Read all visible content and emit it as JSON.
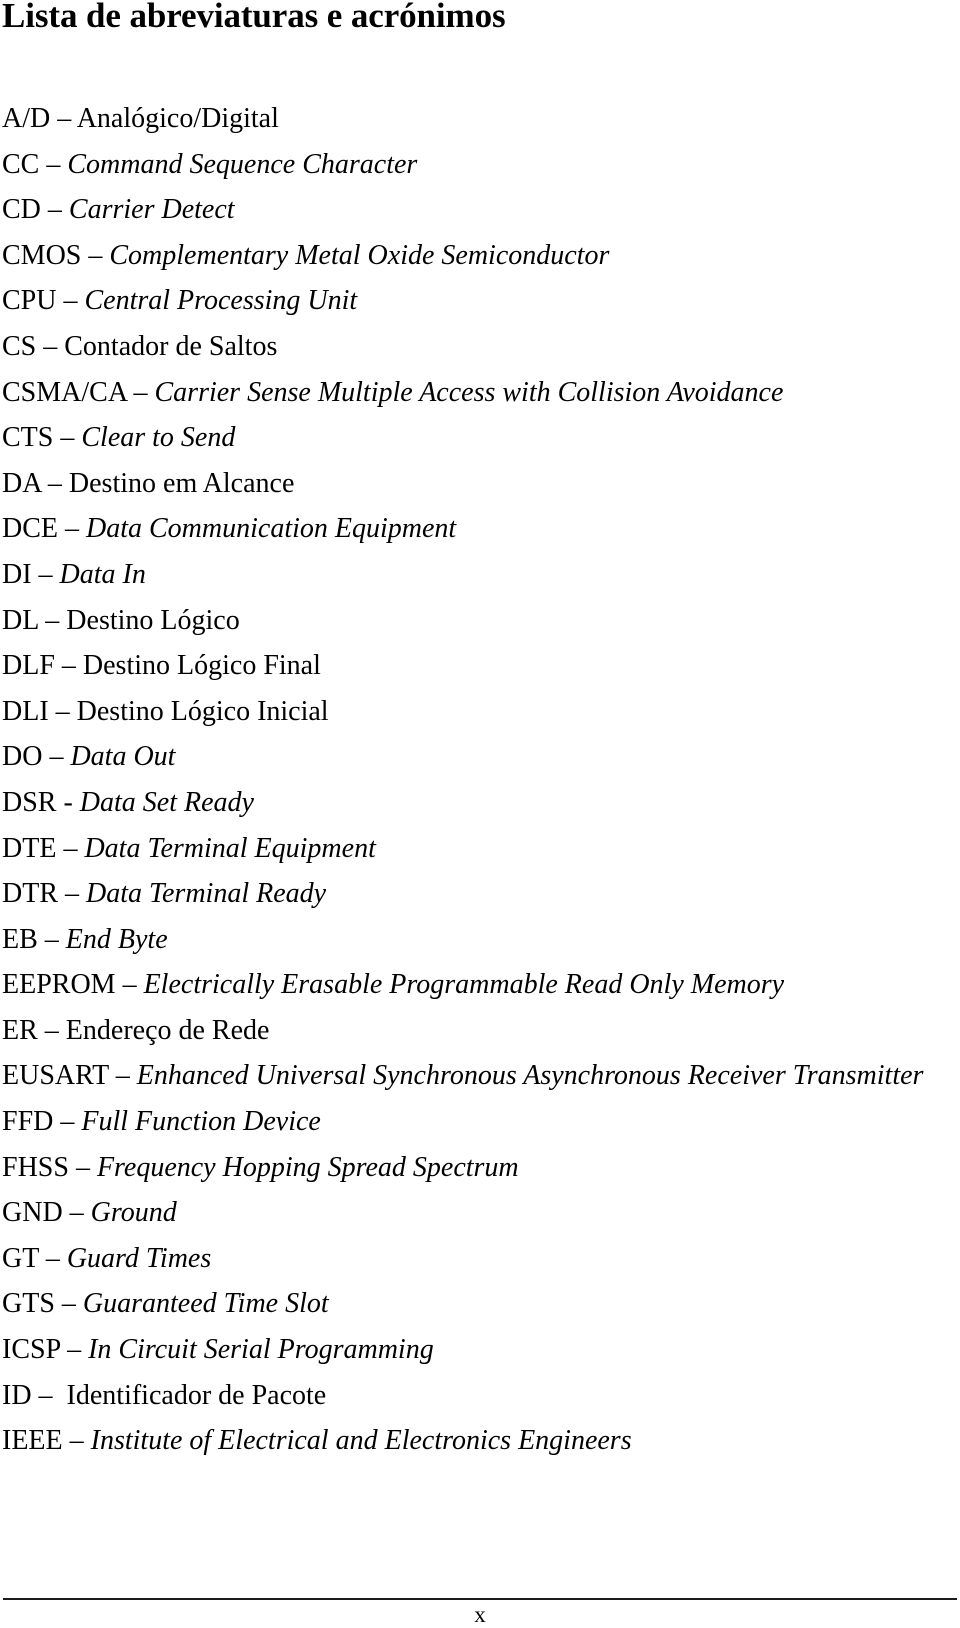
{
  "document": {
    "title": "Lista de abreviaturas e acrónimos",
    "language": "pt",
    "background_color": "#ffffff",
    "text_color": "#000000"
  },
  "abbreviations": [
    {
      "term": "A/D",
      "separator": " – ",
      "definition": "Analógico/Digital",
      "definition_style": "roman"
    },
    {
      "term": "CC",
      "separator": " – ",
      "definition": "Command Sequence Character",
      "definition_style": "italic"
    },
    {
      "term": "CD",
      "separator": " – ",
      "definition": "Carrier Detect",
      "definition_style": "italic"
    },
    {
      "term": "CMOS",
      "separator": " – ",
      "definition": "Complementary Metal Oxide Semiconductor",
      "definition_style": "italic"
    },
    {
      "term": "CPU",
      "separator": " – ",
      "definition": "Central Processing Unit",
      "definition_style": "italic"
    },
    {
      "term": "CS",
      "separator": " – ",
      "definition": "Contador de Saltos",
      "definition_style": "roman"
    },
    {
      "term": "CSMA/CA",
      "separator": " – ",
      "definition": "Carrier Sense Multiple Access with Collision Avoidance",
      "definition_style": "italic"
    },
    {
      "term": "CTS",
      "separator": " – ",
      "definition": "Clear to Send",
      "definition_style": "italic"
    },
    {
      "term": "DA",
      "separator": " – ",
      "definition": "Destino em Alcance",
      "definition_style": "roman"
    },
    {
      "term": "DCE",
      "separator": " – ",
      "definition": "Data Communication Equipment",
      "definition_style": "italic"
    },
    {
      "term": "DI",
      "separator": " – ",
      "definition": "Data In",
      "definition_style": "italic"
    },
    {
      "term": "DL",
      "separator": " – ",
      "definition": "Destino Lógico",
      "definition_style": "roman"
    },
    {
      "term": "DLF",
      "separator": " – ",
      "definition": "Destino Lógico Final",
      "definition_style": "roman"
    },
    {
      "term": "DLI",
      "separator": " – ",
      "definition": "Destino Lógico Inicial",
      "definition_style": "roman"
    },
    {
      "term": "DO",
      "separator": " – ",
      "definition": "Data Out",
      "definition_style": "italic"
    },
    {
      "term": "DSR",
      "separator": " - ",
      "definition": "Data Set Ready",
      "definition_style": "italic"
    },
    {
      "term": "DTE",
      "separator": " – ",
      "definition": "Data Terminal Equipment",
      "definition_style": "italic"
    },
    {
      "term": "DTR",
      "separator": " – ",
      "definition": "Data Terminal Ready",
      "definition_style": "italic"
    },
    {
      "term": "EB",
      "separator": " – ",
      "definition": "End Byte",
      "definition_style": "italic"
    },
    {
      "term": "EEPROM",
      "separator": " – ",
      "definition": "Electrically Erasable Programmable Read Only Memory",
      "definition_style": "italic"
    },
    {
      "term": "ER",
      "separator": " – ",
      "definition": "Endereço de Rede",
      "definition_style": "roman"
    },
    {
      "term": "EUSART",
      "separator": " – ",
      "definition": "Enhanced Universal Synchronous Asynchronous Receiver Transmitter",
      "definition_style": "italic"
    },
    {
      "term": "FFD",
      "separator": " – ",
      "definition": "Full Function Device",
      "definition_style": "italic"
    },
    {
      "term": "FHSS",
      "separator": " – ",
      "definition": "Frequency Hopping Spread Spectrum",
      "definition_style": "italic"
    },
    {
      "term": "GND",
      "separator": " – ",
      "definition": "Ground",
      "definition_style": "italic"
    },
    {
      "term": "GT",
      "separator": " – ",
      "definition": "Guard Times",
      "definition_style": "italic"
    },
    {
      "term": "GTS",
      "separator": " – ",
      "definition": "Guaranteed Time Slot",
      "definition_style": "italic"
    },
    {
      "term": "ICSP",
      "separator": " – ",
      "definition": "In Circuit Serial Programming",
      "definition_style": "italic"
    },
    {
      "term": "ID",
      "separator": " –  ",
      "definition": "Identificador de Pacote",
      "definition_style": "roman"
    },
    {
      "term": "IEEE",
      "separator": " – ",
      "definition": "Institute of Electrical and Electronics Engineers",
      "definition_style": "italic"
    }
  ],
  "footer": {
    "page_number": "x",
    "rule_color": "#1a1a1a"
  }
}
